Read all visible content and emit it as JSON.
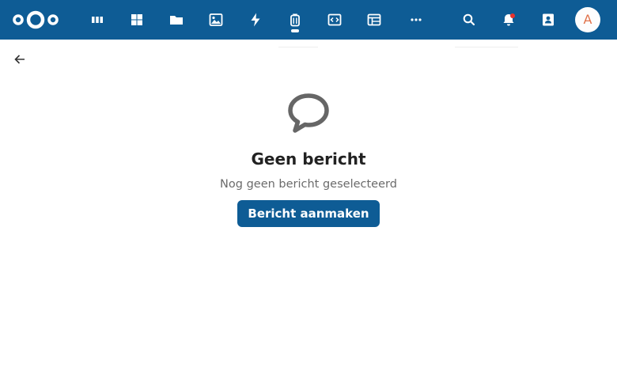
{
  "header": {
    "brand_color": "#0e5c95",
    "logo_icon": "nextcloud-logo-icon",
    "apps": [
      {
        "name": "dashboard-icon",
        "active": false
      },
      {
        "name": "grid-icon",
        "active": false
      },
      {
        "name": "files-icon",
        "active": false
      },
      {
        "name": "photos-icon",
        "active": false
      },
      {
        "name": "activity-icon",
        "active": false
      },
      {
        "name": "mail-icon",
        "active": true
      },
      {
        "name": "text-editor-icon",
        "active": false
      },
      {
        "name": "tables-icon",
        "active": false
      },
      {
        "name": "more-apps-icon",
        "active": false
      }
    ],
    "search_icon": "search-icon",
    "notifications_icon": "bell-icon",
    "contacts_icon": "contacts-icon",
    "avatar": {
      "initial": "A",
      "color": "#e0724a"
    }
  },
  "back_icon": "arrow-left-icon",
  "empty_state": {
    "icon": "speech-bubble-icon",
    "title": "Geen bericht",
    "description": "Nog geen bericht geselecteerd",
    "button_label": "Bericht aanmaken"
  }
}
